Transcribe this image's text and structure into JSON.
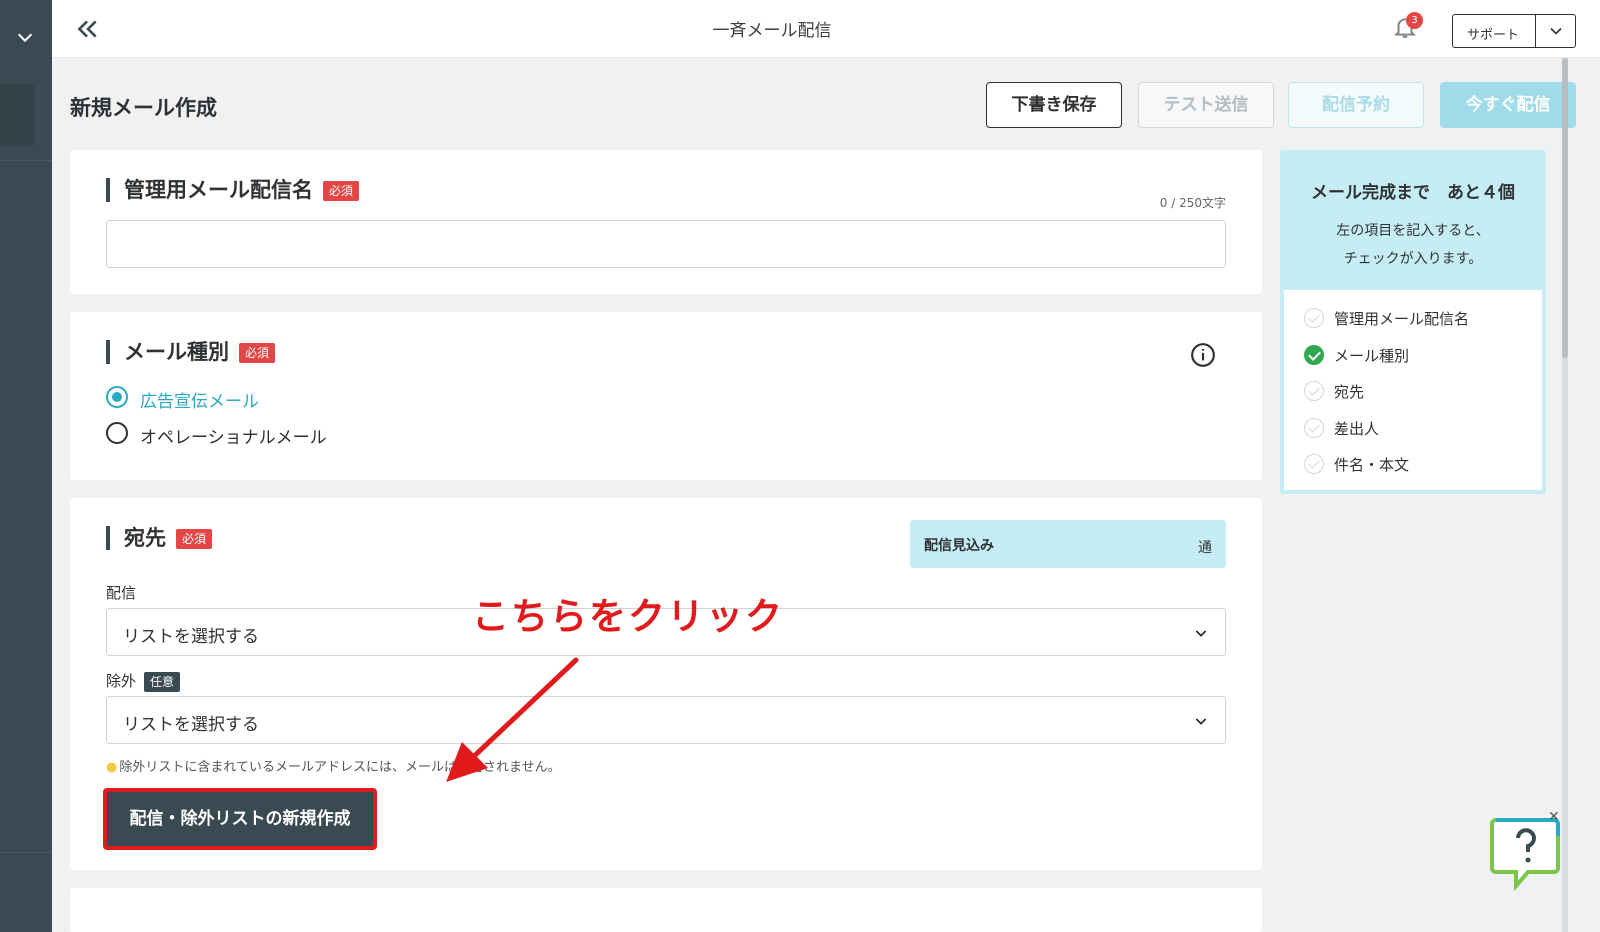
{
  "topbar": {
    "title": "一斉メール配信",
    "notification_count": "3",
    "support_label": "サポート"
  },
  "page": {
    "title": "新規メール作成"
  },
  "toolbar": {
    "draft_label": "下書き保存",
    "test_label": "テスト送信",
    "reserve_label": "配信予約",
    "now_label": "今すぐ配信"
  },
  "required_label": "必須",
  "optional_label": "任意",
  "name_section": {
    "title": "管理用メール配信名",
    "counter": "0 / 250文字",
    "value": ""
  },
  "type_section": {
    "title": "メール種別",
    "options": [
      {
        "label": "広告宣伝メール",
        "selected": true
      },
      {
        "label": "オペレーショナルメール",
        "selected": false
      }
    ]
  },
  "recipient_section": {
    "title": "宛先",
    "forecast_label": "配信見込み",
    "forecast_unit": "通",
    "deliver_label": "配信",
    "deliver_value": "リストを選択する",
    "exclude_label": "除外",
    "exclude_value": "リストを選択する",
    "hint": "除外リストに含まれているメールアドレスには、メールは配信されません。",
    "new_list_button": "配信・除外リストの新規作成"
  },
  "annotation": {
    "text": "こちらをクリック",
    "color": "#e11b1b"
  },
  "side_panel": {
    "heading": "メール完成まで　あと４個",
    "desc_line1": "左の項目を記入すると、",
    "desc_line2": "チェックが入ります。",
    "checklist": [
      {
        "label": "管理用メール配信名",
        "done": false
      },
      {
        "label": "メール種別",
        "done": true
      },
      {
        "label": "宛先",
        "done": false
      },
      {
        "label": "差出人",
        "done": false
      },
      {
        "label": "件名・本文",
        "done": false
      }
    ]
  },
  "colors": {
    "accent": "#29a9c4",
    "sidebar": "#3a4a52",
    "required": "#e24646",
    "check_done": "#2fa84f",
    "side_panel_bg": "#c6edf3"
  }
}
